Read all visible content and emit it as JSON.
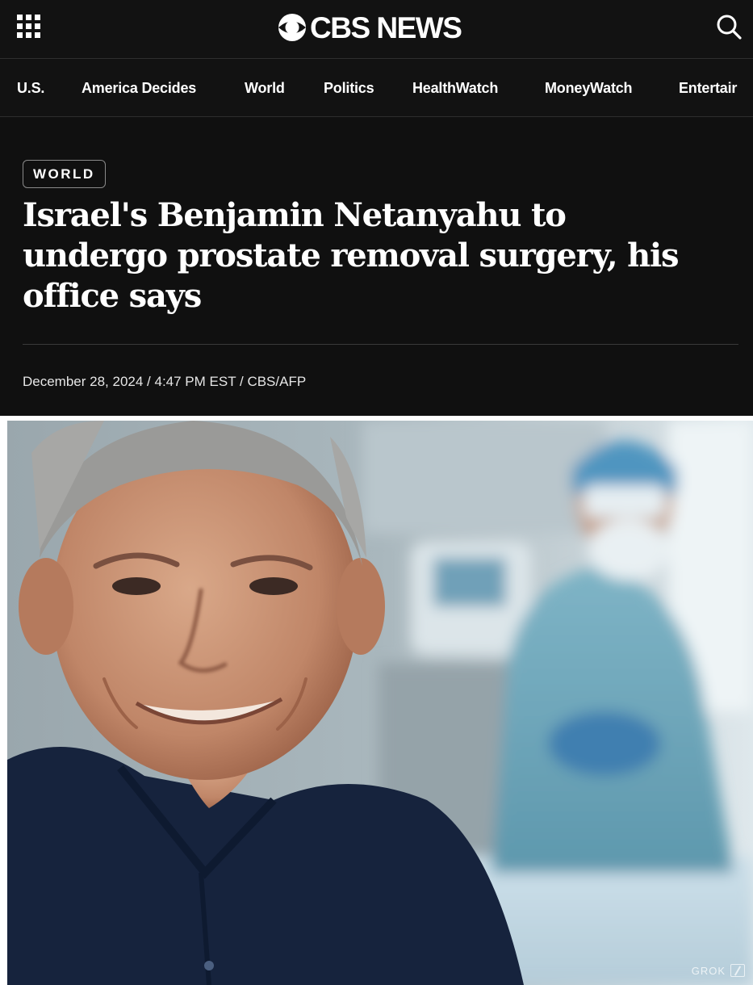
{
  "header": {
    "menu_icon": "grid-menu-icon",
    "logo_icon": "cbs-eye-icon",
    "logo_text": "CBS NEWS",
    "search_icon": "search-icon"
  },
  "nav": {
    "items": [
      {
        "label": "U.S."
      },
      {
        "label": "America Decides"
      },
      {
        "label": "World"
      },
      {
        "label": "Politics"
      },
      {
        "label": "HealthWatch"
      },
      {
        "label": "MoneyWatch"
      },
      {
        "label": "Entertair"
      }
    ]
  },
  "article": {
    "category": "WORLD",
    "headline": "Israel's Benjamin Netanyahu to undergo prostate removal surgery, his office says",
    "byline": "December 28, 2024 / 4:47 PM EST / CBS/AFP"
  },
  "photo": {
    "watermark": "GROK"
  },
  "colors": {
    "background": "#101010",
    "text": "#ffffff",
    "divider": "#3a3a3a"
  }
}
